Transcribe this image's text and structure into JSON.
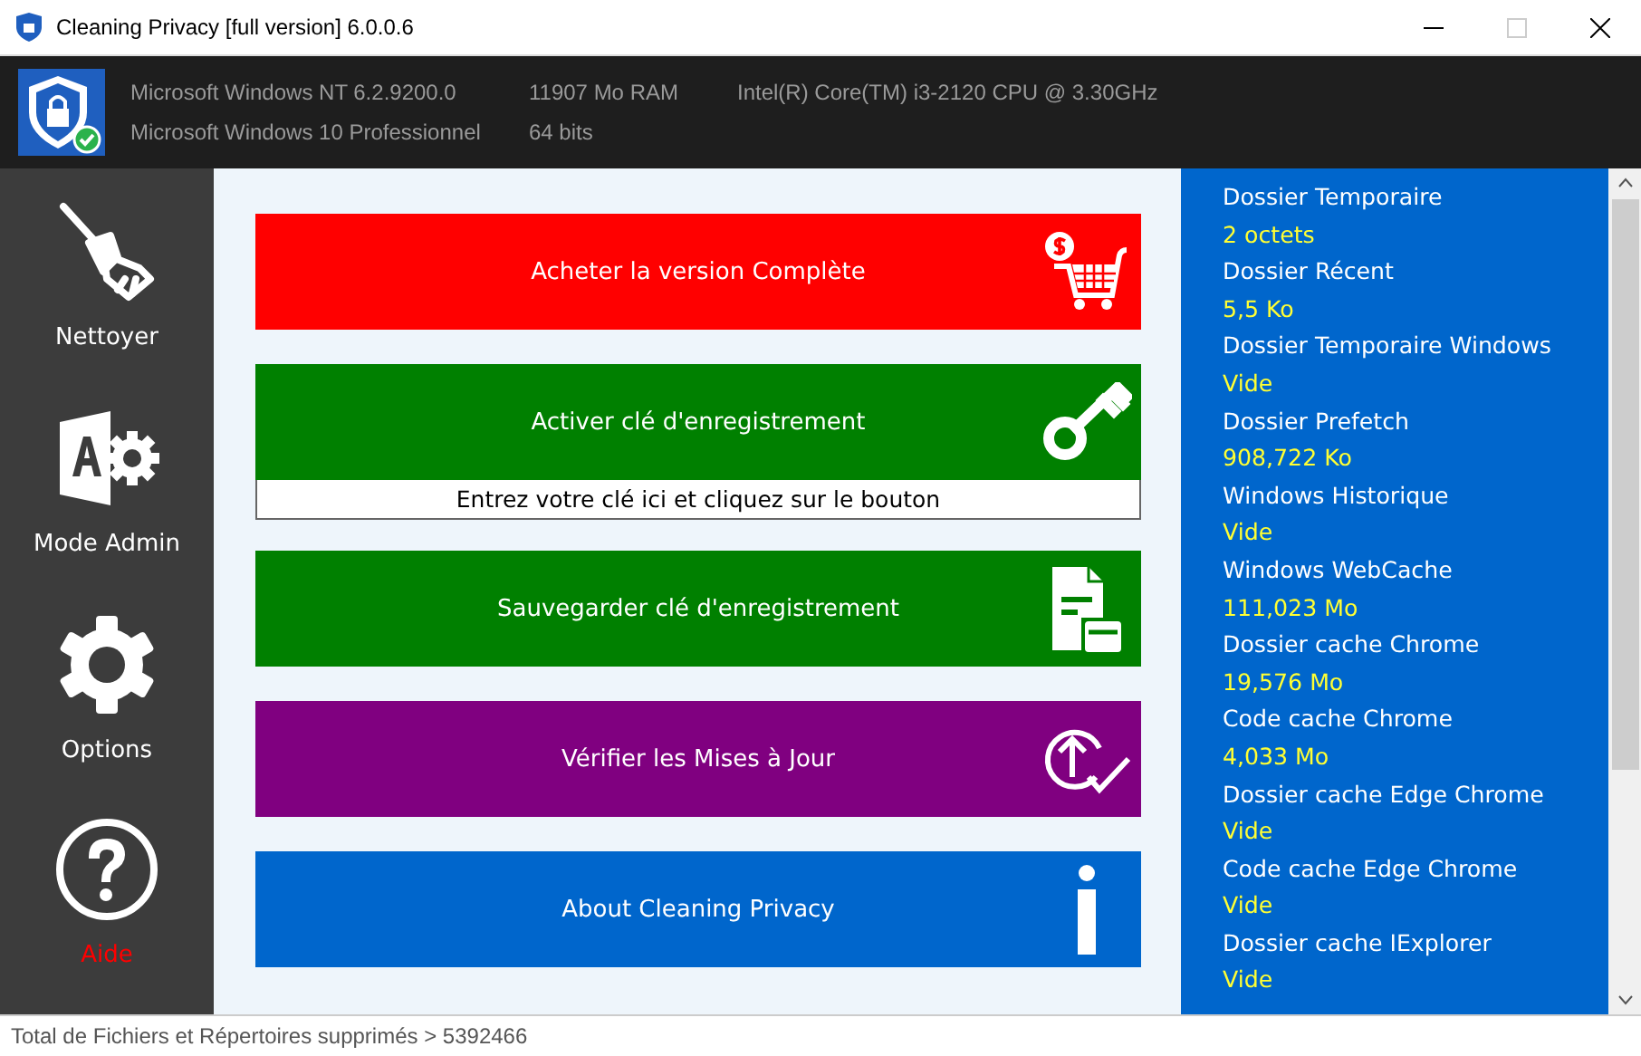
{
  "window": {
    "title": "Cleaning Privacy [full version] 6.0.0.6"
  },
  "system_info": [
    {
      "text": "Microsoft Windows NT 6.2.9200.0"
    },
    {
      "text": "11907 Mo RAM"
    },
    {
      "text": "Intel(R) Core(TM) i3-2120 CPU @ 3.30GHz"
    },
    {
      "text": "Microsoft Windows 10 Professionnel"
    },
    {
      "text": "64 bits"
    }
  ],
  "sidebar": {
    "items": [
      {
        "label": "Nettoyer",
        "kind": "broom",
        "selected": false
      },
      {
        "label": "Mode Admin",
        "kind": "admin",
        "selected": false
      },
      {
        "label": "Options",
        "kind": "gear",
        "selected": false
      },
      {
        "label": "Aide",
        "kind": "help",
        "selected": true
      }
    ]
  },
  "actions": [
    {
      "label": "Acheter la version Complète",
      "kind": "cart",
      "color": "#ff0000"
    },
    {
      "label": "Activer clé d'enregistrement",
      "kind": "key",
      "color": "#008000",
      "field": {
        "placeholder": "Entrez votre clé ici et cliquez sur le bouton"
      }
    },
    {
      "label": "Sauvegarder clé d'enregistrement",
      "kind": "document",
      "color": "#008000"
    },
    {
      "label": "Vérifier les Mises à Jour",
      "kind": "update",
      "color": "#800080"
    },
    {
      "label": "About Cleaning Privacy",
      "kind": "info",
      "color": "#0066cc"
    }
  ],
  "results": [
    {
      "name": "Dossier Temporaire",
      "size": "2 octets"
    },
    {
      "name": "Dossier Récent",
      "size": "5,5 Ko"
    },
    {
      "name": "Dossier Temporaire Windows",
      "size": "Vide"
    },
    {
      "name": "Dossier Prefetch",
      "size": "908,722 Ko"
    },
    {
      "name": "Windows Historique",
      "size": "Vide"
    },
    {
      "name": "Windows WebCache",
      "size": "111,023 Mo"
    },
    {
      "name": "Dossier cache Chrome",
      "size": "19,576 Mo"
    },
    {
      "name": "Code cache Chrome",
      "size": "4,033 Mo"
    },
    {
      "name": "Dossier cache Edge Chrome",
      "size": "Vide"
    },
    {
      "name": "Code cache Edge Chrome",
      "size": "Vide"
    },
    {
      "name": "Dossier cache IExplorer",
      "size": "Vide"
    }
  ],
  "status_bar": {
    "text": "Total de Fichiers et Répertoires supprimés > 5392466"
  }
}
